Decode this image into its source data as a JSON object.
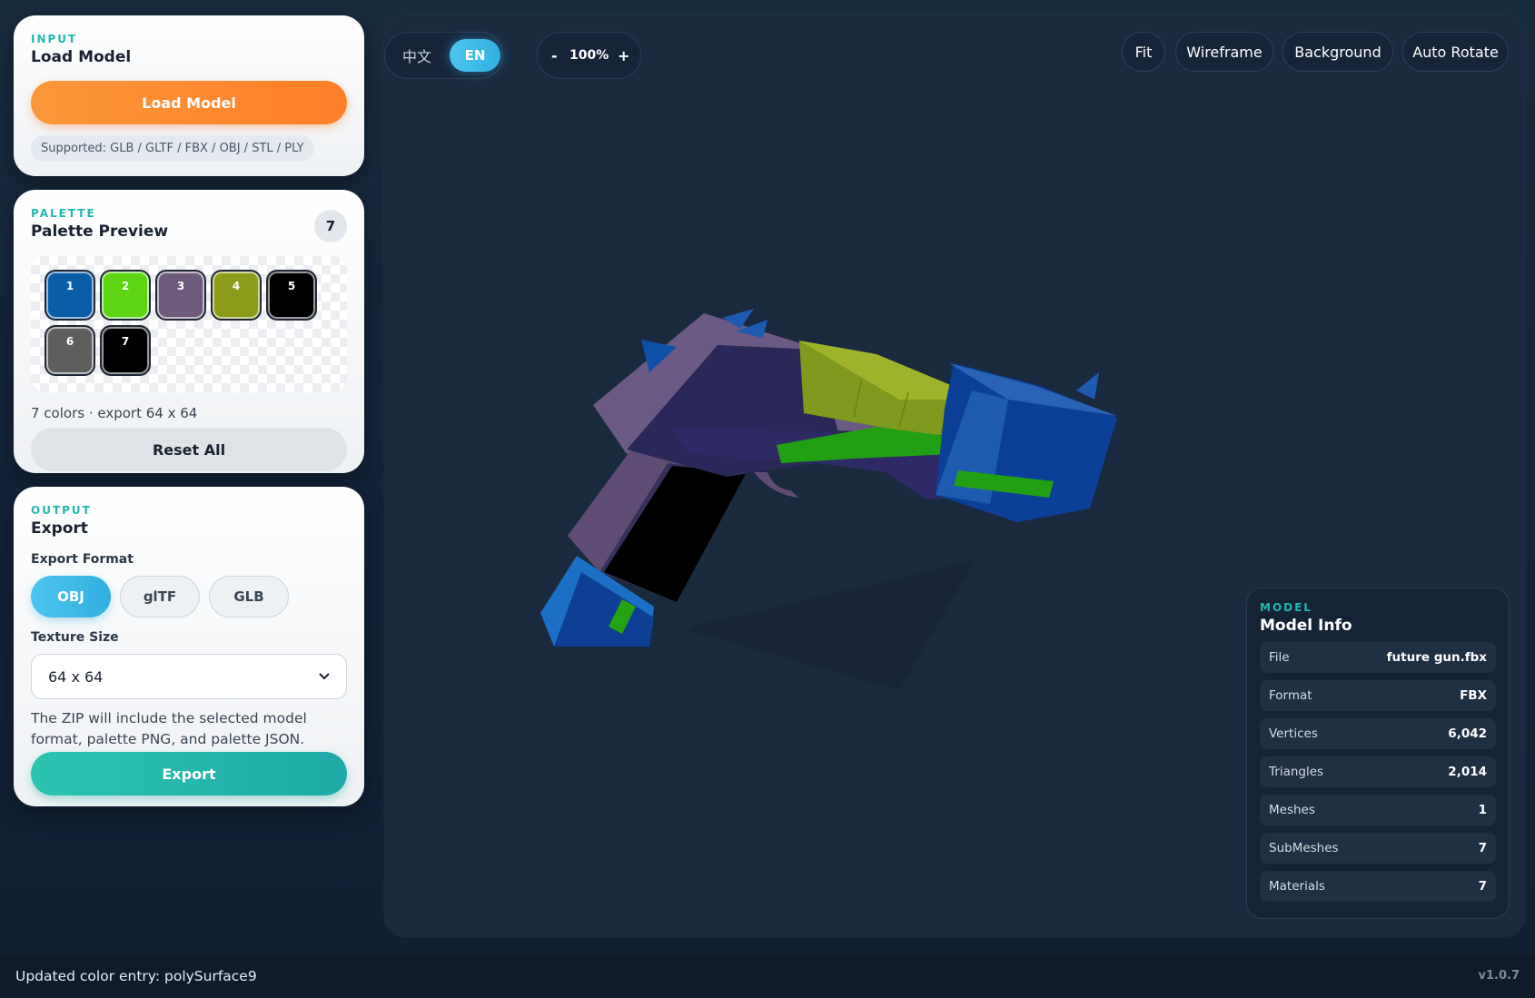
{
  "input": {
    "eyebrow": "INPUT",
    "title": "Load Model",
    "button": "Load Model",
    "supported": "Supported: GLB / GLTF / FBX / OBJ / STL / PLY"
  },
  "palette": {
    "eyebrow": "PALETTE",
    "title": "Palette Preview",
    "count": "7",
    "swatches": [
      {
        "num": "1",
        "color": "#0a5ea8"
      },
      {
        "num": "2",
        "color": "#5cd414"
      },
      {
        "num": "3",
        "color": "#6e5a7c"
      },
      {
        "num": "4",
        "color": "#8c9c1a"
      },
      {
        "num": "5",
        "color": "#000000"
      },
      {
        "num": "6",
        "color": "#5e5e5e"
      },
      {
        "num": "7",
        "color": "#000000"
      }
    ],
    "summary": "7 colors · export 64 x 64",
    "reset": "Reset All"
  },
  "output": {
    "eyebrow": "OUTPUT",
    "title": "Export",
    "format_label": "Export Format",
    "formats": [
      "OBJ",
      "glTF",
      "GLB"
    ],
    "selected_format": "OBJ",
    "texture_label": "Texture Size",
    "texture_value": "64 x 64",
    "note": "The ZIP will include the selected model format, palette PNG, and palette JSON.",
    "export": "Export"
  },
  "toolbar": {
    "lang_zh": "中文",
    "lang_en": "EN",
    "zoom_minus": "-",
    "zoom_value": "100%",
    "zoom_plus": "+",
    "fit": "Fit",
    "wireframe": "Wireframe",
    "background": "Background",
    "auto_rotate": "Auto Rotate"
  },
  "model_info": {
    "eyebrow": "MODEL",
    "title": "Model Info",
    "rows": [
      {
        "k": "File",
        "v": "future gun.fbx"
      },
      {
        "k": "Format",
        "v": "FBX"
      },
      {
        "k": "Vertices",
        "v": "6,042"
      },
      {
        "k": "Triangles",
        "v": "2,014"
      },
      {
        "k": "Meshes",
        "v": "1"
      },
      {
        "k": "SubMeshes",
        "v": "7"
      },
      {
        "k": "Materials",
        "v": "7"
      }
    ]
  },
  "status": {
    "message": "Updated color entry: polySurface9",
    "version": "v1.0.7"
  },
  "colors": {
    "accent_teal": "#22b8b0",
    "accent_orange": "#ff7f28",
    "accent_blue": "#32b0e0",
    "viewport_bg": "#1a2a3e"
  }
}
